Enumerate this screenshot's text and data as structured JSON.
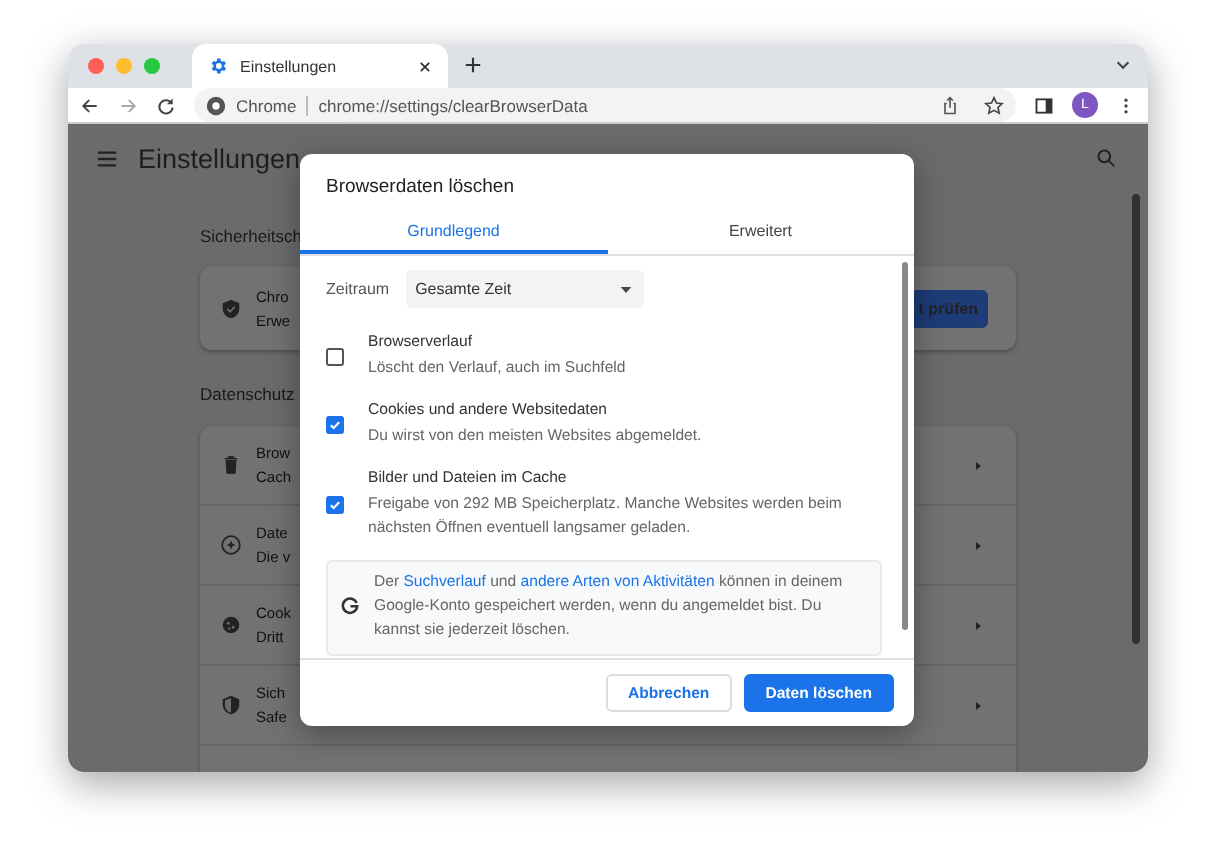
{
  "browser": {
    "tab_title": "Einstellungen",
    "site_label": "Chrome",
    "url": "chrome://settings/clearBrowserData",
    "avatar_letter": "L"
  },
  "settings_page": {
    "title": "Einstellungen",
    "safety": {
      "heading": "Sicherheitsch",
      "title": "Chro",
      "subtitle": "Erwe",
      "button": "t prüfen"
    },
    "privacy": {
      "heading": "Datenschutz",
      "items": [
        {
          "kind": "trash",
          "title": "Brow",
          "subtitle": "Cach"
        },
        {
          "kind": "compass",
          "title": "Date",
          "subtitle": "Die v"
        },
        {
          "kind": "cookie",
          "title": "Cook",
          "subtitle": "Dritt"
        },
        {
          "kind": "shield",
          "title": "Sich",
          "subtitle": "Safe"
        }
      ]
    }
  },
  "dialog": {
    "title": "Browserdaten löschen",
    "tabs": [
      {
        "label": "Grundlegend",
        "selected": true
      },
      {
        "label": "Erweitert",
        "selected": false
      }
    ],
    "time_range": {
      "label": "Zeitraum",
      "value": "Gesamte Zeit"
    },
    "options": [
      {
        "title": "Browserverlauf",
        "description": "Löscht den Verlauf, auch im Suchfeld",
        "checked": false
      },
      {
        "title": "Cookies und andere Websitedaten",
        "description": "Du wirst von den meisten Websites abgemeldet.",
        "checked": true
      },
      {
        "title": "Bilder und Dateien im Cache",
        "description": "Freigabe von 292 MB Speicherplatz. Manche Websites werden beim nächsten Öffnen eventuell langsamer geladen.",
        "checked": true
      }
    ],
    "info": [
      {
        "kind": "plain",
        "text": "Der "
      },
      {
        "kind": "link",
        "text": "Suchverlauf"
      },
      {
        "kind": "plain",
        "text": " und "
      },
      {
        "kind": "link",
        "text": "andere Arten von Aktivitäten"
      },
      {
        "kind": "plain",
        "text": " können in deinem Google-Konto gespeichert werden, wenn du angemeldet bist. Du kannst sie jederzeit löschen."
      }
    ],
    "buttons": {
      "cancel": "Abbrechen",
      "confirm": "Daten löschen"
    }
  }
}
